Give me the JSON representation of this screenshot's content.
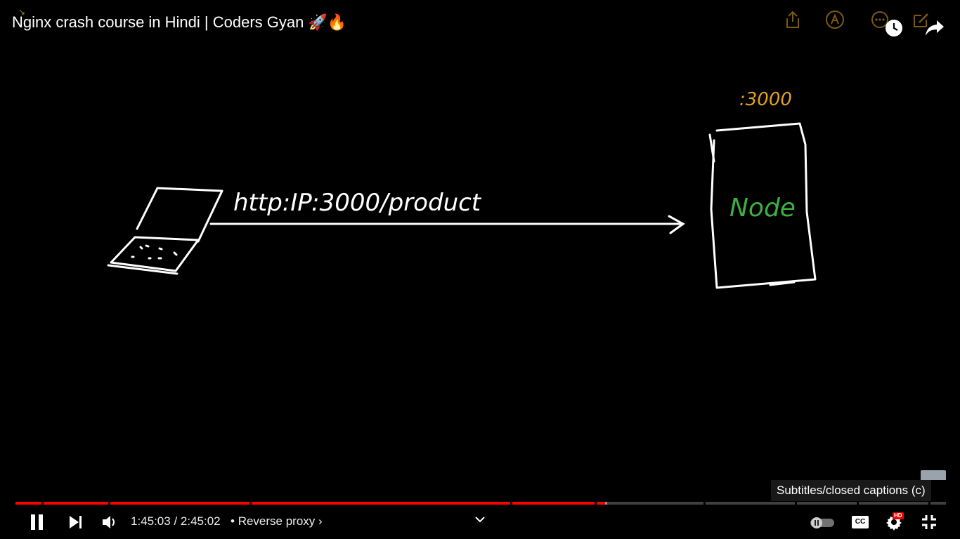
{
  "player": {
    "title": "Nginx crash course in Hindi | Coders Gyan 🚀🔥",
    "top_icons": [
      "share-icon",
      "annotate-icon",
      "more-icon",
      "watch-later-icon",
      "edit-icon",
      "share-arrow-icon"
    ]
  },
  "drawing": {
    "url_label": "http:IP:3000/product",
    "port_label": ":3000",
    "server_label": "Node",
    "colors": {
      "ink": "#ffffff",
      "port": "#e2a21e",
      "server": "#3cb043"
    }
  },
  "controls": {
    "current_time": "1:45:03",
    "duration": "2:45:02",
    "time_text": "1:45:03 / 2:45:02",
    "separator": "•",
    "chapter_title": "Reverse proxy",
    "chapter_chevron": "›",
    "tooltip": "Subtitles/closed captions (c)",
    "hd_badge": "HD",
    "cc_label": "CC",
    "progress_played_fraction": 0.636,
    "progress_buffered_fraction": 0.641
  },
  "colors": {
    "progress_played": "#ff0000",
    "background": "#000000"
  }
}
